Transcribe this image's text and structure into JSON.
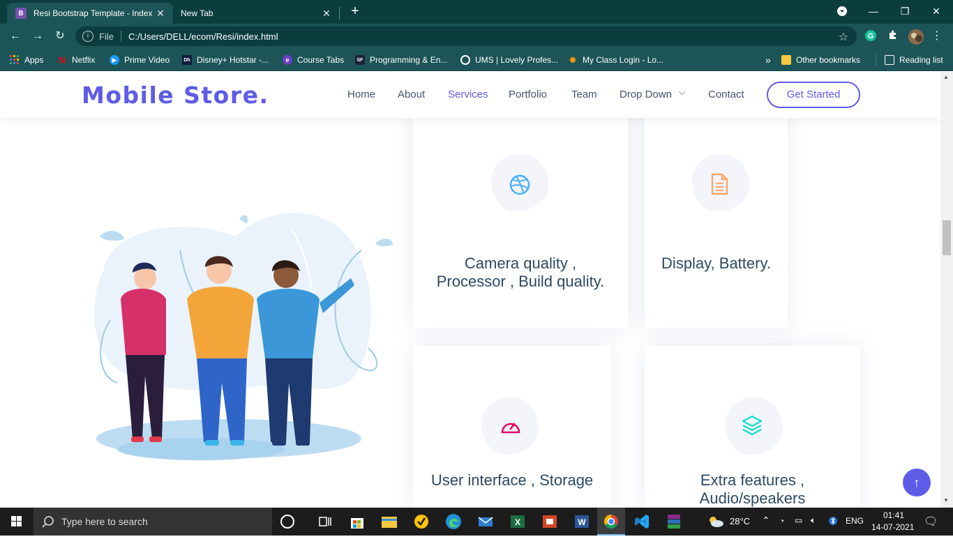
{
  "browser": {
    "tabs": [
      {
        "favicon": "B",
        "title": "Resi Bootstrap Template - Index",
        "active": true
      },
      {
        "title": "New Tab",
        "active": false
      }
    ],
    "address": {
      "scheme_label": "File",
      "url": "C:/Users/DELL/ecom/Resi/index.html"
    },
    "bookmarks": [
      {
        "label": "Apps",
        "icon": "apps-grid-icon"
      },
      {
        "label": "Netflix",
        "icon": "netflix-icon"
      },
      {
        "label": "Prime Video",
        "icon": "prime-video-icon"
      },
      {
        "label": "Disney+ Hotstar -...",
        "icon": "hotstar-icon"
      },
      {
        "label": "Course Tabs",
        "icon": "course-tabs-icon"
      },
      {
        "label": "Programming & En...",
        "icon": "programming-icon"
      },
      {
        "label": "UMS | Lovely Profes...",
        "icon": "globe-icon"
      },
      {
        "label": "My Class Login - Lo...",
        "icon": "my-class-icon"
      }
    ],
    "bookmarks_overflow": "»",
    "other_bookmarks": "Other bookmarks",
    "reading_list": "Reading list"
  },
  "site": {
    "logo": "Mobile Store.",
    "nav": [
      {
        "label": "Home",
        "active": false
      },
      {
        "label": "About",
        "active": false
      },
      {
        "label": "Services",
        "active": true
      },
      {
        "label": "Portfolio",
        "active": false
      },
      {
        "label": "Team",
        "active": false
      },
      {
        "label": "Drop Down",
        "active": false,
        "dropdown": true
      },
      {
        "label": "Contact",
        "active": false
      }
    ],
    "cta": "Get Started",
    "services": [
      {
        "title_line1": "Camera quality ,",
        "title_line2": "Processor , Build quality.",
        "icon": "dribbble-icon",
        "icon_color": "#47aeff"
      },
      {
        "title_line1": "Display, Battery.",
        "title_line2": "",
        "icon": "document-icon",
        "icon_color": "#ffa76e"
      },
      {
        "title_line1": "User interface , Storage",
        "title_line2": "",
        "icon": "speedometer-icon",
        "icon_color": "#e80368"
      },
      {
        "title_line1": "Extra features ,",
        "title_line2": "Audio/speakers",
        "icon": "layers-icon",
        "icon_color": "#11dbcf"
      }
    ]
  },
  "taskbar": {
    "search_placeholder": "Type here to search",
    "weather": "28°C",
    "language": "ENG",
    "time": "01:41",
    "date": "14-07-2021"
  },
  "colors": {
    "brand": "#5e5ce6",
    "text": "#2c4964",
    "chrome_dark": "#0b3d3f",
    "chrome_mid": "#1c5457"
  }
}
